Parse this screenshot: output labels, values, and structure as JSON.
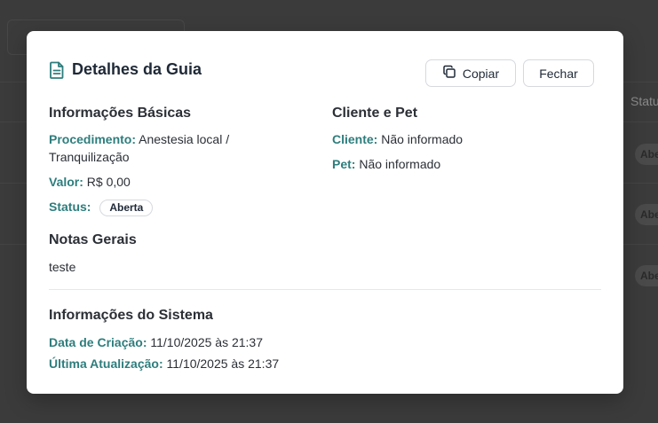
{
  "modal": {
    "title": "Detalhes da Guia",
    "copy_label": "Copiar",
    "close_label": "Fechar"
  },
  "basic": {
    "heading": "Informações Básicas",
    "procedimento_label": "Procedimento:",
    "procedimento_value_line1": "Anestesia local /",
    "procedimento_value_line2": "Tranquilização",
    "valor_label": "Valor:",
    "valor_value": "R$ 0,00",
    "status_label": "Status:",
    "status_value": "Aberta"
  },
  "client": {
    "heading": "Cliente e Pet",
    "cliente_label": "Cliente:",
    "cliente_value": "Não informado",
    "pet_label": "Pet:",
    "pet_value": "Não informado"
  },
  "notes": {
    "heading": "Notas Gerais",
    "text": "teste"
  },
  "system": {
    "heading": "Informações do Sistema",
    "created_label": "Data de Criação:",
    "created_value": "11/10/2025 às 21:37",
    "updated_label": "Última Atualização:",
    "updated_value": "11/10/2025 às 21:37"
  },
  "background": {
    "status_header": "Status",
    "badge_text": "Abe"
  },
  "colors": {
    "accent": "#2e7d7d",
    "overlay": "#3b3b3b"
  }
}
